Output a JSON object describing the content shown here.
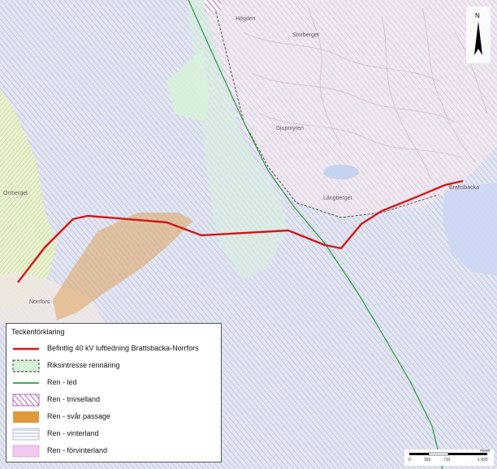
{
  "legend": {
    "title": "Teckenförklaring",
    "items": [
      {
        "label": "Befintlig 40 kV luftledning Brattsbacka-Norrfors",
        "symbol": "red-line"
      },
      {
        "label": "Riksintresse rennäring",
        "symbol": "dashed-green-box"
      },
      {
        "label": "Ren - led",
        "symbol": "green-line"
      },
      {
        "label": "Ren - trivselland",
        "symbol": "purple-hatch"
      },
      {
        "label": "Ren - svår passage",
        "symbol": "orange-fill"
      },
      {
        "label": "Ren - vinterland",
        "symbol": "blue-hatch"
      },
      {
        "label": "Ren - förvinterland",
        "symbol": "pink-fill"
      }
    ]
  },
  "places": {
    "brattsbacka": "Brattsbacka",
    "norrfors": "Norrfors",
    "orrberget": "Orrberget",
    "lanberg": "Långberget",
    "storberget": "Storberget",
    "hojden": "Högden",
    "djupmyren": "Djupmyren"
  },
  "north_label": "N",
  "scale": {
    "labels": [
      "0",
      "355",
      "710",
      "1 420"
    ],
    "unit": "meter"
  },
  "colors": {
    "power_line": "#d0191a",
    "reindeer_route": "#2f9a46",
    "riksintresse": "#d7f1d9",
    "svar_passage": "#dfa460",
    "vinterland": "#c7d0ea",
    "forvinterland": "#f2c8ee",
    "trivselland": "#b03bb5",
    "background": "#dfe3ef"
  }
}
